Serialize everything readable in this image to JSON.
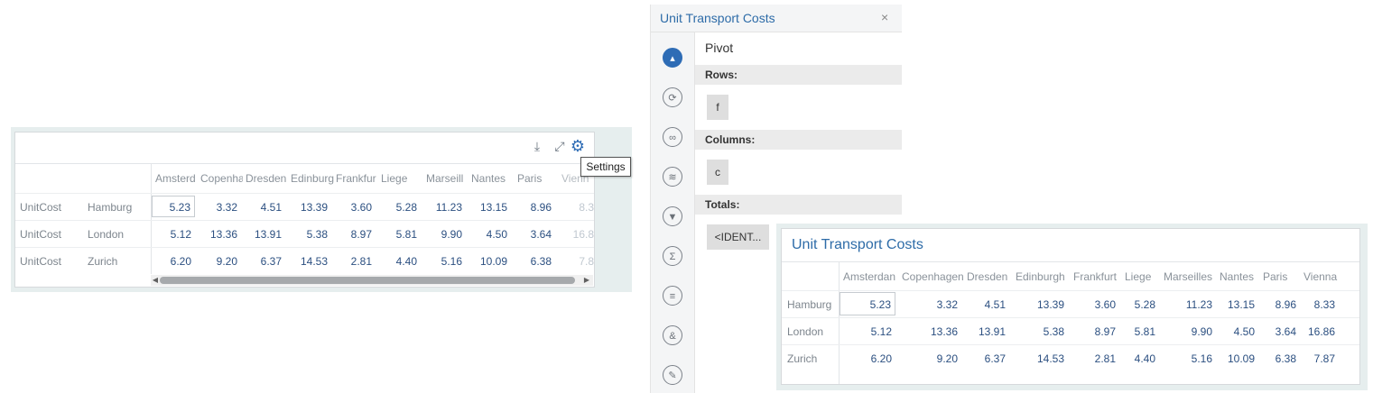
{
  "left_widget": {
    "tooltip": "Settings",
    "icons": {
      "download": "download-icon",
      "expand": "expand-icon",
      "settings": "gear-icon"
    },
    "columns": [
      "Amsterd",
      "Copenha",
      "Dresden",
      "Edinburg",
      "Frankfur",
      "Liege",
      "Marseill",
      "Nantes",
      "Paris",
      "Vienn"
    ],
    "rows": [
      {
        "label1": "UnitCost",
        "label2": "Hamburg",
        "values": [
          "5.23",
          "3.32",
          "4.51",
          "13.39",
          "3.60",
          "5.28",
          "11.23",
          "13.15",
          "8.96",
          "8.3"
        ]
      },
      {
        "label1": "UnitCost",
        "label2": "London",
        "values": [
          "5.12",
          "13.36",
          "13.91",
          "5.38",
          "8.97",
          "5.81",
          "9.90",
          "4.50",
          "3.64",
          "16.8"
        ]
      },
      {
        "label1": "UnitCost",
        "label2": "Zurich",
        "values": [
          "6.20",
          "9.20",
          "6.37",
          "14.53",
          "2.81",
          "4.40",
          "5.16",
          "10.09",
          "6.38",
          "7.8"
        ]
      }
    ]
  },
  "panel": {
    "title": "Unit Transport Costs",
    "close": "×",
    "pivot_label": "Pivot",
    "rows_label": "Rows:",
    "rows_chip": "f",
    "columns_label": "Columns:",
    "columns_chip": "c",
    "totals_label": "Totals:",
    "totals_chip": "<IDENT...",
    "rail_icons": [
      "pivot-icon",
      "refresh-icon",
      "link-icon",
      "layers-icon",
      "filter-icon",
      "sum-icon",
      "list-icon",
      "ampersand-icon",
      "wrench-icon"
    ]
  },
  "right_table": {
    "title": "Unit Transport Costs",
    "columns": [
      "Amsterdan",
      "Copenhagen",
      "Dresden",
      "Edinburgh",
      "Frankfurt",
      "Liege",
      "Marseilles",
      "Nantes",
      "Paris",
      "Vienna"
    ],
    "rows": [
      {
        "label": "Hamburg",
        "values": [
          "5.23",
          "3.32",
          "4.51",
          "13.39",
          "3.60",
          "5.28",
          "11.23",
          "13.15",
          "8.96",
          "8.33"
        ]
      },
      {
        "label": "London",
        "values": [
          "5.12",
          "13.36",
          "13.91",
          "5.38",
          "8.97",
          "5.81",
          "9.90",
          "4.50",
          "3.64",
          "16.86"
        ]
      },
      {
        "label": "Zurich",
        "values": [
          "6.20",
          "9.20",
          "6.37",
          "14.53",
          "2.81",
          "4.40",
          "5.16",
          "10.09",
          "6.38",
          "7.87"
        ]
      }
    ]
  }
}
